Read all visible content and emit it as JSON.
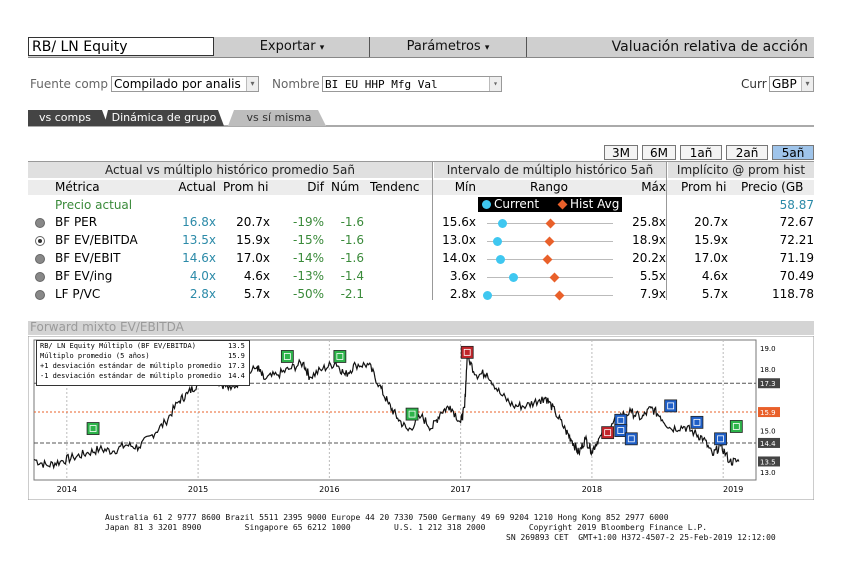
{
  "header": {
    "ticker": "RB/ LN Equity",
    "menu_export": "Exportar",
    "menu_params": "Parámetros",
    "screen_title": "Valuación relativa de acción"
  },
  "controls": {
    "source_label": "Fuente comp",
    "source_value": "Compilado por analis",
    "name_label": "Nombre",
    "name_value": "BI EU HHP Mfg Val",
    "curr_label": "Curr",
    "curr_value": "GBP"
  },
  "tabs": [
    "vs comps",
    "Dinámica de grupo",
    "vs sí misma"
  ],
  "periods": [
    "3M",
    "6M",
    "1añ",
    "2añ",
    "5añ"
  ],
  "active_period": "5añ",
  "table": {
    "group1": "Actual vs múltiplo histórico promedio 5añ",
    "group2": "Intervalo de múltiplo histórico 5añ",
    "group3": "Implícito @ prom hist",
    "col_metric": "Métrica",
    "col_actual": "Actual",
    "col_avg": "Prom hi",
    "col_diff": "Dif",
    "col_num": "Núm",
    "col_trend": "Tendenc",
    "col_min": "Mín",
    "col_range": "Rango",
    "col_max": "Máx",
    "col_impl_avg": "Prom hi",
    "col_price": "Precio (GB",
    "legend_current": "Current",
    "legend_hist": "Hist Avg",
    "price_label": "Precio actual",
    "price_value": "58.87",
    "rows": [
      {
        "metric": "BF PER",
        "actual": "16.8x",
        "avg": "20.7x",
        "diff": "-19%",
        "num": "-1.6",
        "min": "15.6x",
        "max": "25.8x",
        "impl_avg": "20.7x",
        "price": "72.67",
        "cur_frac": 0.12,
        "hist_frac": 0.5,
        "selected": false
      },
      {
        "metric": "BF EV/EBITDA",
        "actual": "13.5x",
        "avg": "15.9x",
        "diff": "-15%",
        "num": "-1.6",
        "min": "13.0x",
        "max": "18.9x",
        "impl_avg": "15.9x",
        "price": "72.21",
        "cur_frac": 0.08,
        "hist_frac": 0.49,
        "selected": true
      },
      {
        "metric": "BF EV/EBIT",
        "actual": "14.6x",
        "avg": "17.0x",
        "diff": "-14%",
        "num": "-1.6",
        "min": "14.0x",
        "max": "20.2x",
        "impl_avg": "17.0x",
        "price": "71.19",
        "cur_frac": 0.1,
        "hist_frac": 0.48,
        "selected": false
      },
      {
        "metric": "BF EV/ing",
        "actual": "4.0x",
        "avg": "4.6x",
        "diff": "-13%",
        "num": "-1.4",
        "min": "3.6x",
        "max": "5.5x",
        "impl_avg": "4.6x",
        "price": "70.49",
        "cur_frac": 0.21,
        "hist_frac": 0.53,
        "selected": false
      },
      {
        "metric": "LF P/VC",
        "actual": "2.8x",
        "avg": "5.7x",
        "diff": "-50%",
        "num": "-2.1",
        "min": "2.8x",
        "max": "7.9x",
        "impl_avg": "5.7x",
        "price": "118.78",
        "cur_frac": 0.0,
        "hist_frac": 0.57,
        "selected": false
      }
    ]
  },
  "chart": {
    "title": "Forward mixto EV/EBITDA",
    "legend": [
      {
        "text": "RB/ LN Equity Múltiplo (BF EV/EBITDA)",
        "value": "13.5"
      },
      {
        "text": "Múltiplo promedio (5 años)",
        "value": "15.9"
      },
      {
        "text": "+1 desviación estándar de múltiplo promedio",
        "value": "17.3"
      },
      {
        "text": "-1 desviación estándar de múltiplo promedio",
        "value": "14.4"
      }
    ],
    "x_labels": [
      "2014",
      "2015",
      "2016",
      "2017",
      "2018",
      "2019"
    ],
    "y_labels": [
      "19.0",
      "18.0",
      "17.3",
      "15.9",
      "15.0",
      "14.4",
      "13.5",
      "13.0"
    ],
    "colors": {
      "green": "#2db34a",
      "blue": "#1f5fc7",
      "red": "#c0252a",
      "orange": "#e9602a"
    }
  },
  "chart_data": {
    "type": "line",
    "title": "Forward mixto EV/EBITDA",
    "x_range": [
      "2013-10",
      "2019-03"
    ],
    "ylim": [
      12.6,
      19.4
    ],
    "series": [
      {
        "name": "RB/ LN Equity Múltiplo (BF EV/EBITDA)",
        "points": [
          [
            "2013.75",
            13.6
          ],
          [
            "2013.85",
            13.3
          ],
          [
            "2013.95",
            13.5
          ],
          [
            "2014.05",
            13.7
          ],
          [
            "2014.15",
            13.9
          ],
          [
            "2014.25",
            14.1
          ],
          [
            "2014.35",
            14.0
          ],
          [
            "2014.45",
            14.3
          ],
          [
            "2014.55",
            14.2
          ],
          [
            "2014.65",
            14.8
          ],
          [
            "2014.75",
            15.4
          ],
          [
            "2014.85",
            16.4
          ],
          [
            "2014.92",
            16.8
          ],
          [
            "2015.0",
            17.3
          ],
          [
            "2015.08",
            17.8
          ],
          [
            "2015.15",
            17.4
          ],
          [
            "2015.25",
            17.0
          ],
          [
            "2015.35",
            17.6
          ],
          [
            "2015.45",
            18.1
          ],
          [
            "2015.5",
            17.5
          ],
          [
            "2015.6",
            17.7
          ],
          [
            "2015.7",
            18.0
          ],
          [
            "2015.8",
            18.3
          ],
          [
            "2015.85",
            17.6
          ],
          [
            "2015.95",
            18.0
          ],
          [
            "2016.05",
            18.3
          ],
          [
            "2016.12",
            17.7
          ],
          [
            "2016.2",
            18.2
          ],
          [
            "2016.3",
            18.2
          ],
          [
            "2016.38",
            17.2
          ],
          [
            "2016.45",
            16.3
          ],
          [
            "2016.52",
            15.6
          ],
          [
            "2016.6",
            15.0
          ],
          [
            "2016.7",
            15.7
          ],
          [
            "2016.78",
            15.1
          ],
          [
            "2016.85",
            15.9
          ],
          [
            "2016.92",
            16.2
          ],
          [
            "2017.0",
            15.4
          ],
          [
            "2017.03",
            16.1
          ],
          [
            "2017.05",
            18.6
          ],
          [
            "2017.12",
            17.7
          ],
          [
            "2017.2",
            17.8
          ],
          [
            "2017.3",
            16.8
          ],
          [
            "2017.4",
            16.2
          ],
          [
            "2017.5",
            16.2
          ],
          [
            "2017.6",
            16.5
          ],
          [
            "2017.65",
            16.6
          ],
          [
            "2017.72",
            15.9
          ],
          [
            "2017.8",
            15.0
          ],
          [
            "2017.85",
            14.5
          ],
          [
            "2017.9",
            13.9
          ],
          [
            "2017.95",
            14.6
          ],
          [
            "2018.0",
            14.0
          ],
          [
            "2018.05",
            14.6
          ],
          [
            "2018.12",
            14.9
          ],
          [
            "2018.2",
            15.7
          ],
          [
            "2018.3",
            15.9
          ],
          [
            "2018.38",
            15.6
          ],
          [
            "2018.45",
            16.1
          ],
          [
            "2018.52",
            15.7
          ],
          [
            "2018.6",
            15.1
          ],
          [
            "2018.7",
            15.2
          ],
          [
            "2018.78",
            14.9
          ],
          [
            "2018.85",
            14.6
          ],
          [
            "2018.92",
            13.8
          ],
          [
            "2018.98",
            14.3
          ],
          [
            "2019.05",
            13.5
          ],
          [
            "2019.12",
            13.5
          ]
        ]
      }
    ],
    "reference_lines": [
      {
        "name": "Múltiplo promedio (5 años)",
        "value": 15.9
      },
      {
        "name": "+1 desviación estándar de múltiplo promedio",
        "value": 17.3
      },
      {
        "name": "-1 desviación estándar de múltiplo promedio",
        "value": 14.4
      }
    ]
  },
  "footer": {
    "line1": "Australia 61 2 9777 8600 Brazil 5511 2395 9000 Europe 44 20 7330 7500 Germany 49 69 9204 1210 Hong Kong 852 2977 6000",
    "line2": "Japan 81 3 3201 8900         Singapore 65 6212 1000         U.S. 1 212 318 2000         Copyright 2019 Bloomberg Finance L.P.",
    "line3": "SN 269893 CET  GMT+1:00 H372-4507-2 25-Feb-2019 12:12:00"
  }
}
